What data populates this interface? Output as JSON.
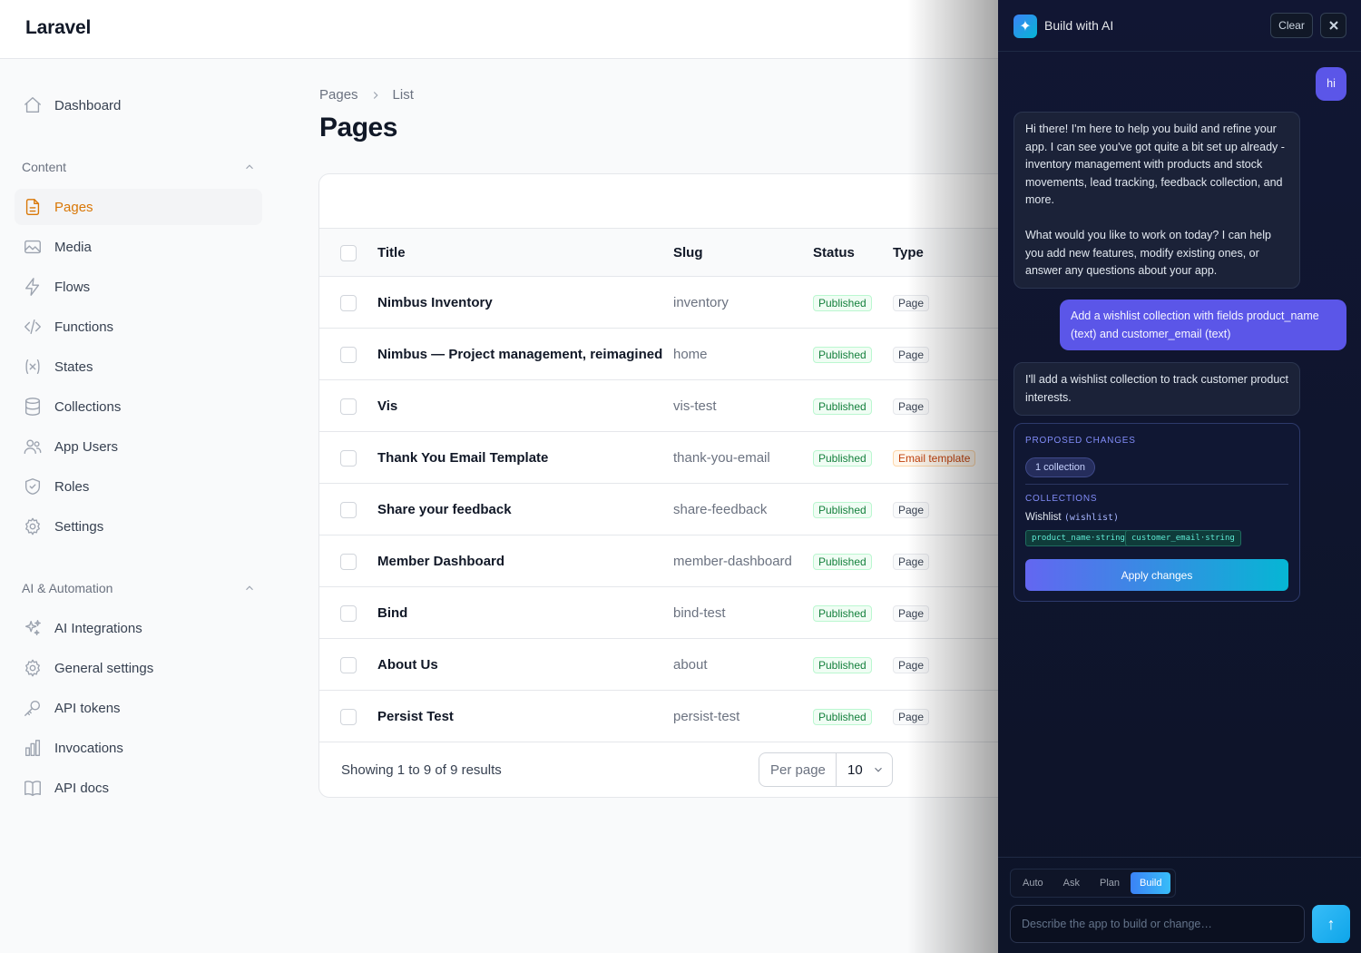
{
  "app": {
    "brand": "Laravel"
  },
  "sidebar": {
    "top": [
      {
        "label": "Dashboard",
        "icon": "home-icon"
      }
    ],
    "groups": [
      {
        "label": "Content",
        "items": [
          {
            "label": "Pages",
            "icon": "document-icon",
            "active": true
          },
          {
            "label": "Media",
            "icon": "image-icon"
          },
          {
            "label": "Flows",
            "icon": "bolt-icon"
          },
          {
            "label": "Functions",
            "icon": "code-icon"
          },
          {
            "label": "States",
            "icon": "variable-icon"
          },
          {
            "label": "Collections",
            "icon": "database-icon"
          },
          {
            "label": "App Users",
            "icon": "users-icon"
          },
          {
            "label": "Roles",
            "icon": "shield-icon"
          },
          {
            "label": "Settings",
            "icon": "gear-icon"
          }
        ]
      },
      {
        "label": "AI & Automation",
        "items": [
          {
            "label": "AI Integrations",
            "icon": "sparkles-icon"
          },
          {
            "label": "General settings",
            "icon": "gear-icon"
          },
          {
            "label": "API tokens",
            "icon": "key-icon"
          },
          {
            "label": "Invocations",
            "icon": "bar-chart-icon"
          },
          {
            "label": "API docs",
            "icon": "book-icon"
          }
        ]
      }
    ]
  },
  "main": {
    "breadcrumb": [
      "Pages",
      "List"
    ],
    "title": "Pages",
    "table": {
      "columns": [
        "Title",
        "Slug",
        "Status",
        "Type"
      ],
      "rows": [
        {
          "title": "Nimbus Inventory",
          "slug": "inventory",
          "status": "Published",
          "type": "Page"
        },
        {
          "title": "Nimbus — Project management, reimagined",
          "slug": "home",
          "status": "Published",
          "type": "Page"
        },
        {
          "title": "Vis",
          "slug": "vis-test",
          "status": "Published",
          "type": "Page"
        },
        {
          "title": "Thank You Email Template",
          "slug": "thank-you-email",
          "status": "Published",
          "type": "Email template"
        },
        {
          "title": "Share your feedback",
          "slug": "share-feedback",
          "status": "Published",
          "type": "Page"
        },
        {
          "title": "Member Dashboard",
          "slug": "member-dashboard",
          "status": "Published",
          "type": "Page"
        },
        {
          "title": "Bind",
          "slug": "bind-test",
          "status": "Published",
          "type": "Page"
        },
        {
          "title": "About Us",
          "slug": "about",
          "status": "Published",
          "type": "Page"
        },
        {
          "title": "Persist Test",
          "slug": "persist-test",
          "status": "Published",
          "type": "Page"
        }
      ]
    },
    "footer": {
      "results": "Showing 1 to 9 of 9 results",
      "per_page_label": "Per page",
      "per_page_value": "10"
    }
  },
  "ai_panel": {
    "title": "Build with AI",
    "clear_label": "Clear",
    "messages": {
      "user_1": "hi",
      "ai_1": "Hi there! I'm here to help you build and refine your app. I can see you've got quite a bit set up already - inventory management with products and stock movements, lead tracking, feedback collection, and more.\n\nWhat would you like to work on today? I can help you add new features, modify existing ones, or answer any questions about your app.",
      "user_2": "Add a wishlist collection with fields product_name (text) and customer_email (text)",
      "ai_2": "I'll add a wishlist collection to track customer product interests."
    },
    "proposal": {
      "heading": "PROPOSED CHANGES",
      "summary_pill": "1 collection",
      "section": "COLLECTIONS",
      "collection_name": "Wishlist",
      "collection_key": "(wishlist)",
      "fields": [
        "product_name·string",
        "customer_email·string"
      ],
      "apply_label": "Apply changes"
    },
    "modes": [
      "Auto",
      "Ask",
      "Plan",
      "Build"
    ],
    "active_mode": "Build",
    "input_placeholder": "Describe the app to build or change…",
    "send_icon": "↑"
  }
}
